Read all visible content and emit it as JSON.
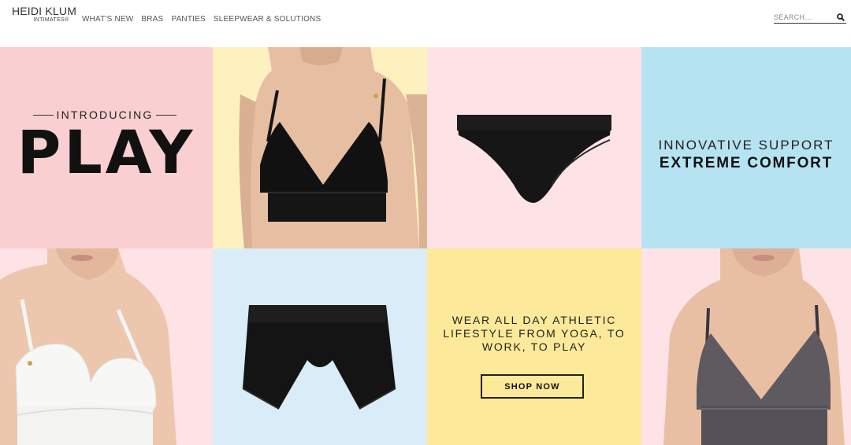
{
  "brand": {
    "name": "HEIDI KLUM",
    "sub": "INTIMATES®"
  },
  "nav": {
    "items": [
      {
        "label": "WHAT'S NEW"
      },
      {
        "label": "BRAS"
      },
      {
        "label": "PANTIES"
      },
      {
        "label": "SLEEPWEAR & SOLUTIONS"
      }
    ]
  },
  "search": {
    "placeholder": "SEARCH...",
    "icon": "search-icon"
  },
  "hero": {
    "introducing": "INTRODUCING",
    "headline": "PLAY",
    "support_line1": "INNOVATIVE SUPPORT",
    "support_line2": "EXTREME COMFORT",
    "wear_text": "WEAR ALL DAY ATHLETIC LIFESTYLE FROM  YOGA, TO WORK, TO PLAY",
    "shop_label": "SHOP NOW"
  },
  "colors": {
    "pink": "#f9cfd1",
    "light_pink": "#fde3e6",
    "cream": "#fdf1c0",
    "sky_blue": "#b5e3f1",
    "pale_blue": "#d9ecf8",
    "yellow": "#fde99a",
    "text_dark": "#111111"
  }
}
